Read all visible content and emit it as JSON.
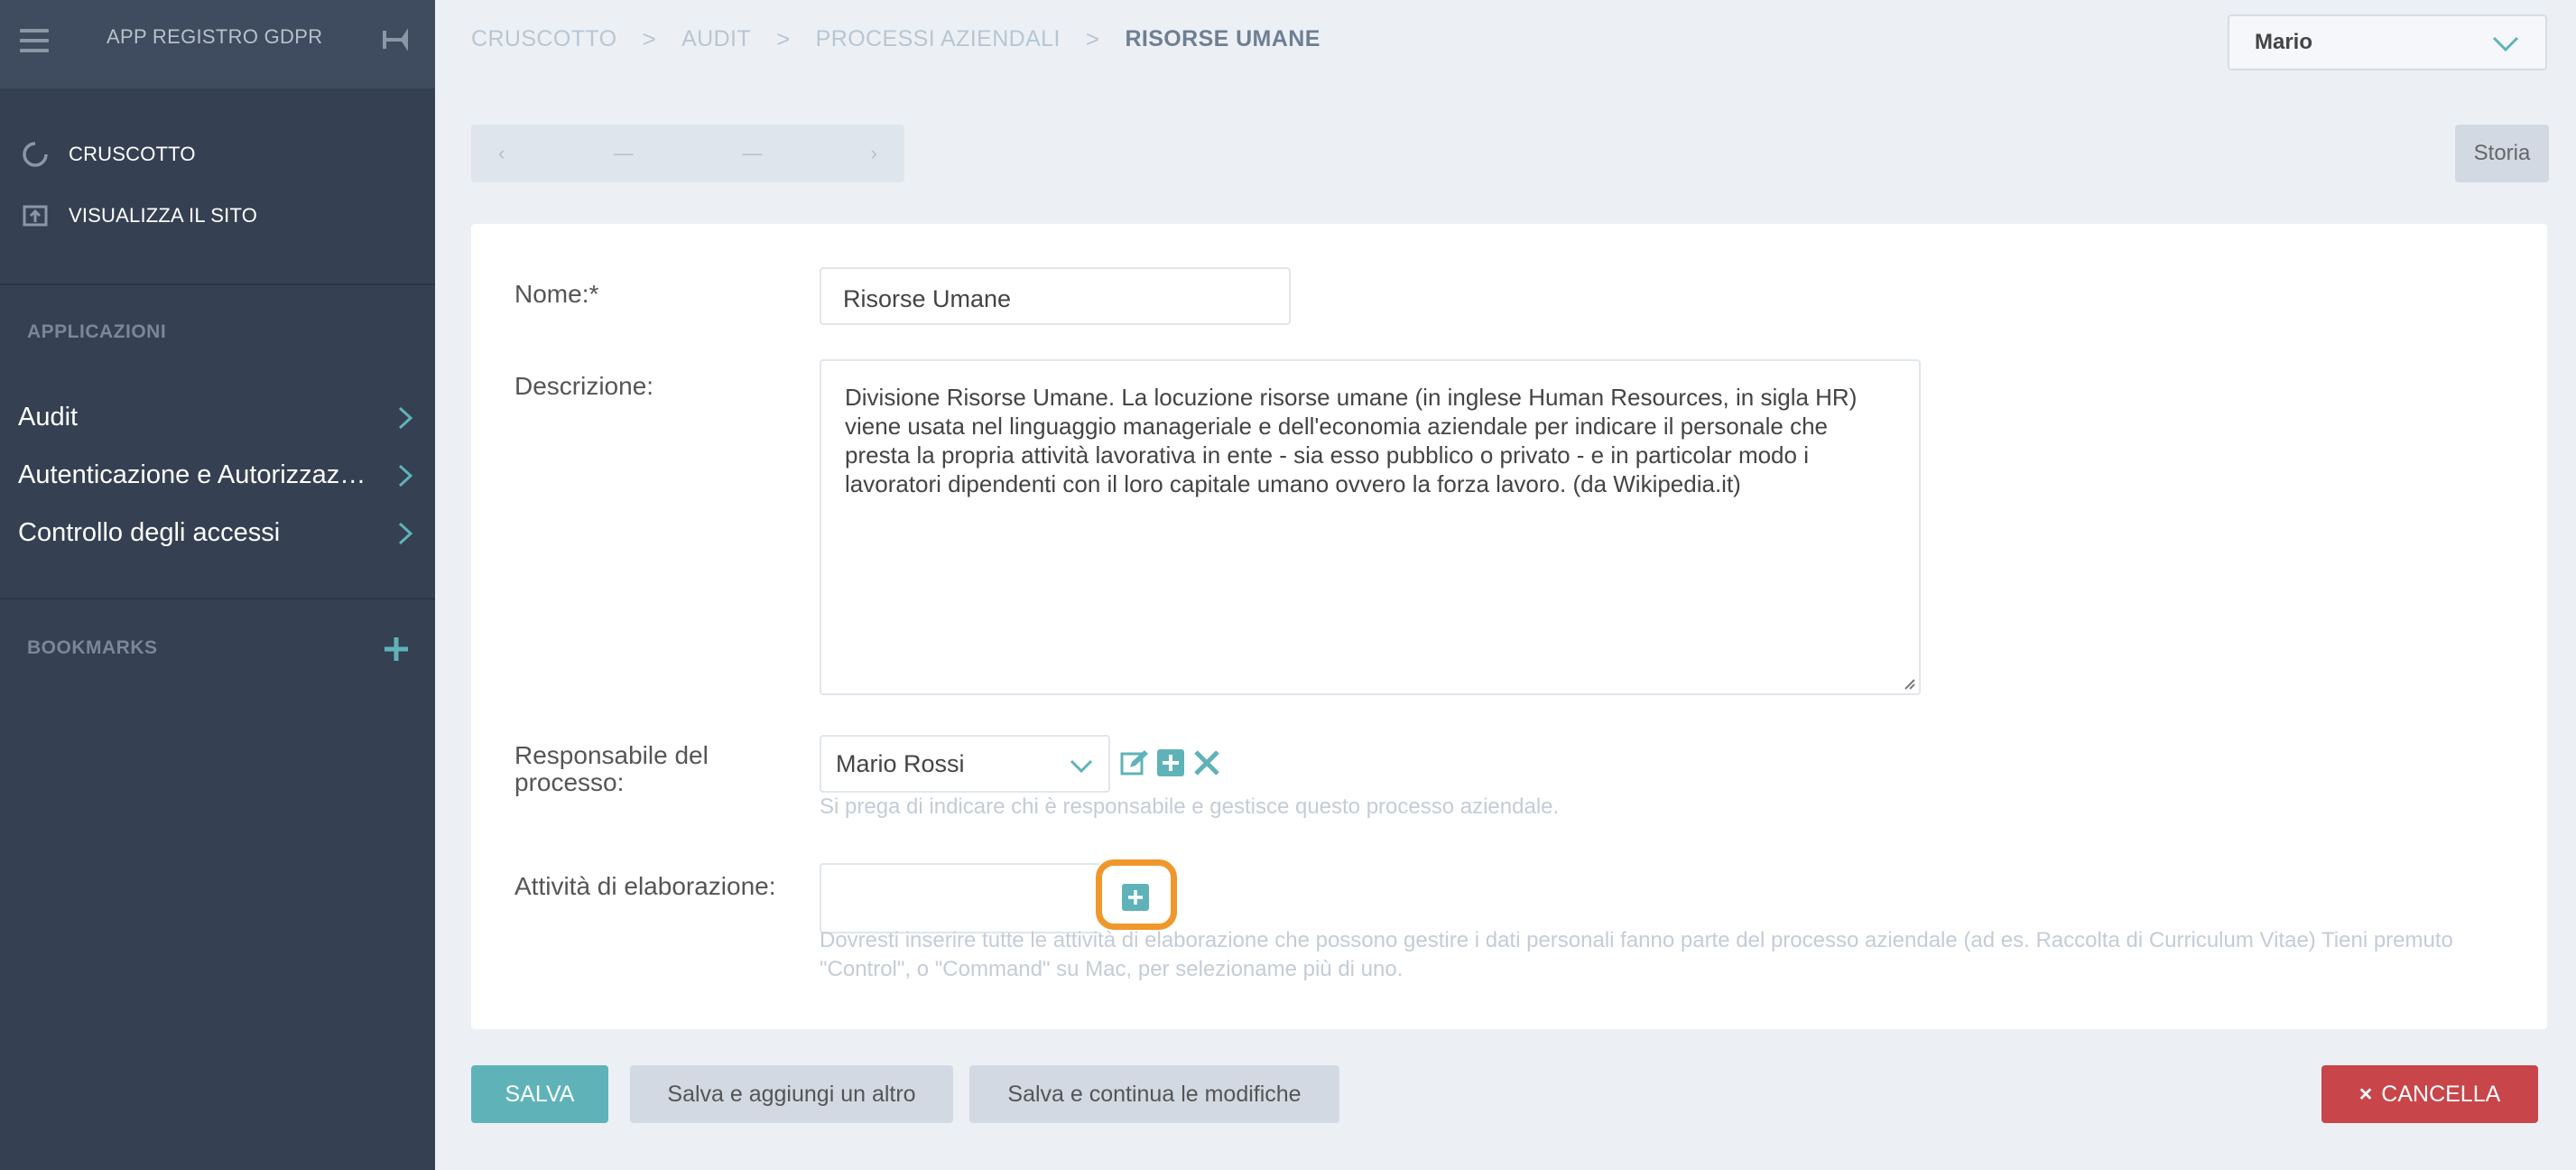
{
  "sidebar": {
    "app_title": "APP REGISTRO GDPR",
    "links": [
      {
        "label": "CRUSCOTTO",
        "icon": "dashboard-icon"
      },
      {
        "label": "VISUALIZZA IL SITO",
        "icon": "view-site-icon"
      }
    ],
    "applications_heading": "APPLICAZIONI",
    "apps": [
      {
        "label": "Audit"
      },
      {
        "label": "Autenticazione e Autorizzazi…"
      },
      {
        "label": "Controllo degli accessi"
      }
    ],
    "bookmarks_heading": "BOOKMARKS"
  },
  "header": {
    "breadcrumb": [
      "CRUSCOTTO",
      "AUDIT",
      "PROCESSI AZIENDALI"
    ],
    "breadcrumb_current": "RISORSE UMANE",
    "user": "Mario"
  },
  "pager": {
    "prev": "‹",
    "left": "—",
    "right": "—",
    "next": "›"
  },
  "history_button": "Storia",
  "form": {
    "name_label": "Nome:*",
    "name_value": "Risorse Umane",
    "description_label": "Descrizione:",
    "description_lines": [
      "Divisione Risorse Umane. La locuzione risorse umane (in inglese Human Resources, in sigla HR)",
      "viene usata nel linguaggio manageriale e dell'economia aziendale per indicare il personale che",
      "presta la propria attività lavorativa in ente - sia esso pubblico o privato - e in particolar modo i",
      "lavoratori dipendenti con il loro capitale umano ovvero la forza lavoro. (da Wikipedia.it)"
    ],
    "owner_label_1": "Responsabile del",
    "owner_label_2": "processo:",
    "owner_value": "Mario Rossi",
    "owner_help": "Si prega di indicare chi è responsabile e gestisce questo processo aziendale.",
    "activities_label": "Attività di elaborazione:",
    "activities_help_1": "Dovresti inserire tutte le attività di elaborazione che possono gestire i dati personali fanno parte del processo aziendale (ad es. Raccolta di Curriculum Vitae) Tieni premuto",
    "activities_help_2": "\"Control\", o \"Command\" su Mac, per selezioname più di uno."
  },
  "buttons": {
    "save": "SALVA",
    "save_add": "Salva e aggiungi un altro",
    "save_continue": "Salva e continua le modifiche",
    "delete": "CANCELLA",
    "delete_icon": "×"
  },
  "colors": {
    "sidebar": "#354052",
    "accent": "#5fb3b8",
    "danger": "#c8454a",
    "highlight": "#f0972c"
  }
}
